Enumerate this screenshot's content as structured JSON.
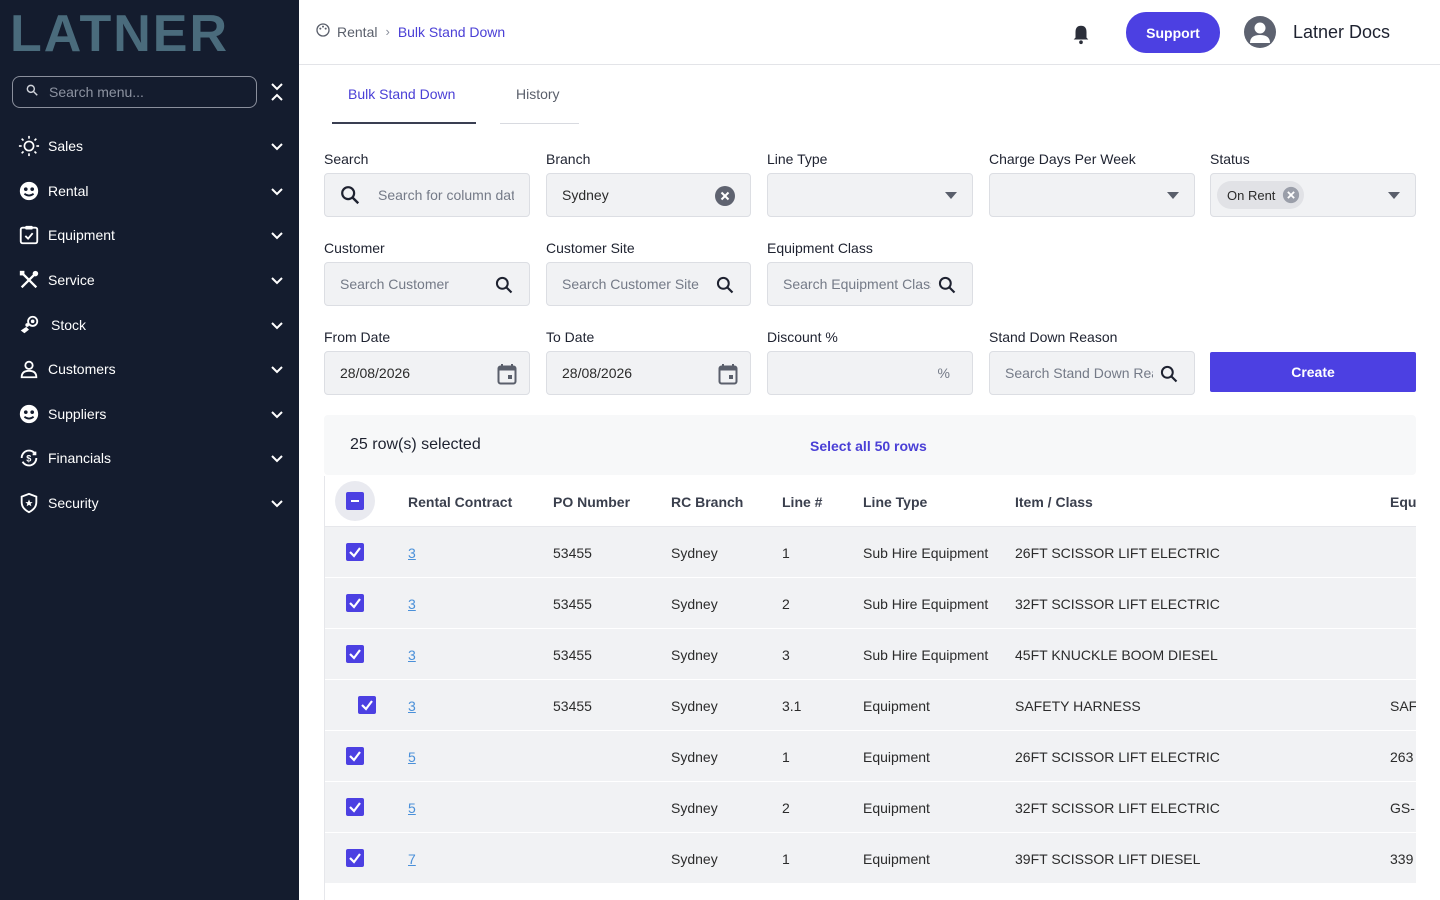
{
  "sidebar": {
    "logo_text": "LATNER",
    "search_placeholder": "Search menu...",
    "items": [
      {
        "label": "Sales",
        "icon": "sales-icon"
      },
      {
        "label": "Rental",
        "icon": "rental-icon"
      },
      {
        "label": "Equipment",
        "icon": "equipment-icon"
      },
      {
        "label": "Service",
        "icon": "service-icon"
      },
      {
        "label": "Stock",
        "icon": "stock-icon"
      },
      {
        "label": "Customers",
        "icon": "customers-icon"
      },
      {
        "label": "Suppliers",
        "icon": "suppliers-icon"
      },
      {
        "label": "Financials",
        "icon": "financials-icon"
      },
      {
        "label": "Security",
        "icon": "security-icon"
      }
    ]
  },
  "header": {
    "breadcrumb": [
      "Rental",
      "Bulk Stand Down"
    ],
    "support_label": "Support",
    "user_name": "Latner Docs"
  },
  "tabs": [
    {
      "label": "Bulk Stand Down",
      "active": true
    },
    {
      "label": "History",
      "active": false
    }
  ],
  "filters": {
    "search": {
      "label": "Search",
      "placeholder": "Search for column data"
    },
    "branch": {
      "label": "Branch",
      "value": "Sydney"
    },
    "line_type": {
      "label": "Line Type",
      "value": ""
    },
    "charge_days": {
      "label": "Charge Days Per Week",
      "value": ""
    },
    "status": {
      "label": "Status",
      "chip": "On Rent"
    },
    "customer": {
      "label": "Customer",
      "placeholder": "Search Customer"
    },
    "customer_site": {
      "label": "Customer Site",
      "placeholder": "Search Customer Site"
    },
    "equipment_class": {
      "label": "Equipment Class",
      "placeholder": "Search Equipment Class"
    },
    "from_date": {
      "label": "From Date",
      "value": "28/08/2026"
    },
    "to_date": {
      "label": "To Date",
      "value": "28/08/2026"
    },
    "discount": {
      "label": "Discount %",
      "value": "",
      "suffix": "%"
    },
    "stand_down_reason": {
      "label": "Stand Down Reason",
      "placeholder": "Search Stand Down Reason"
    },
    "create_label": "Create"
  },
  "selection": {
    "count_text": "25 row(s) selected",
    "select_all_text": "Select all 50 rows"
  },
  "table": {
    "columns": [
      "Rental Contract",
      "PO Number",
      "RC Branch",
      "Line #",
      "Line Type",
      "Item / Class",
      "Equ"
    ],
    "rows": [
      {
        "contract": "3",
        "po": "53455",
        "branch": "Sydney",
        "line": "1",
        "line_type": "Sub Hire Equipment",
        "item": "26FT SCISSOR LIFT ELECTRIC",
        "equ": ""
      },
      {
        "contract": "3",
        "po": "53455",
        "branch": "Sydney",
        "line": "2",
        "line_type": "Sub Hire Equipment",
        "item": "32FT SCISSOR LIFT ELECTRIC",
        "equ": ""
      },
      {
        "contract": "3",
        "po": "53455",
        "branch": "Sydney",
        "line": "3",
        "line_type": "Sub Hire Equipment",
        "item": "45FT KNUCKLE BOOM DIESEL",
        "equ": ""
      },
      {
        "contract": "3",
        "po": "53455",
        "branch": "Sydney",
        "line": "3.1",
        "line_type": "Equipment",
        "item": "SAFETY HARNESS",
        "equ": "SAF"
      },
      {
        "contract": "5",
        "po": "",
        "branch": "Sydney",
        "line": "1",
        "line_type": "Equipment",
        "item": "26FT SCISSOR LIFT ELECTRIC",
        "equ": "263"
      },
      {
        "contract": "5",
        "po": "",
        "branch": "Sydney",
        "line": "2",
        "line_type": "Equipment",
        "item": "32FT SCISSOR LIFT ELECTRIC",
        "equ": "GS-"
      },
      {
        "contract": "7",
        "po": "",
        "branch": "Sydney",
        "line": "1",
        "line_type": "Equipment",
        "item": "39FT SCISSOR LIFT DIESEL",
        "equ": "339"
      }
    ]
  },
  "colors": {
    "accent": "#4c40e2",
    "sidebar_bg": "#141c2e",
    "logo": "#4a6b7c"
  }
}
